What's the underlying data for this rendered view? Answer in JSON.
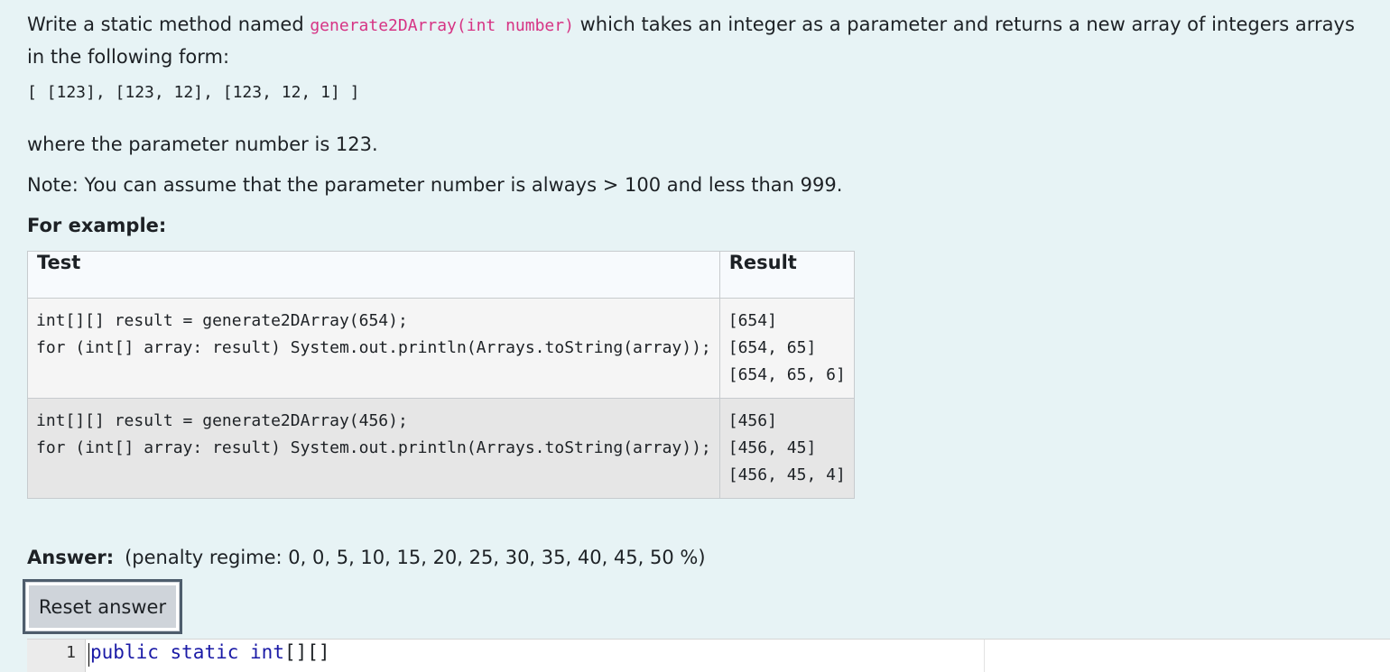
{
  "question": {
    "intro_before": "Write a static method named ",
    "method_signature": "generate2DArray(int number)",
    "intro_after": " which takes an integer as a parameter and returns a new array of integers arrays in the following form:",
    "example_output": "[ [123], [123, 12], [123, 12, 1] ]",
    "where_text": "where the parameter number is 123.",
    "note_text": "Note: You can assume that the parameter number is always > 100 and less than 999.",
    "for_example_label": "For example:"
  },
  "examples_table": {
    "header_test": "Test",
    "header_result": "Result",
    "rows": [
      {
        "test": "int[][] result = generate2DArray(654);\nfor (int[] array: result) System.out.println(Arrays.toString(array));",
        "result": "[654]\n[654, 65]\n[654, 65, 6]"
      },
      {
        "test": "int[][] result = generate2DArray(456);\nfor (int[] array: result) System.out.println(Arrays.toString(array));",
        "result": "[456]\n[456, 45]\n[456, 45, 4]"
      }
    ]
  },
  "answer": {
    "label": "Answer:",
    "penalty_text": "(penalty regime: 0, 0, 5, 10, 15, 20, 25, 30, 35, 40, 45, 50 %)",
    "reset_button_label": "Reset answer"
  },
  "editor": {
    "line_number": "1",
    "keyword_public": "public",
    "keyword_static": "static",
    "keyword_int": "int",
    "code_rest": "[][]"
  },
  "colors": {
    "background": "#e7f3f5",
    "inline_code": "#d63384",
    "keyword": "#1a1aa6",
    "button_background": "#cfd4da",
    "button_border": "#4e5d6c"
  }
}
